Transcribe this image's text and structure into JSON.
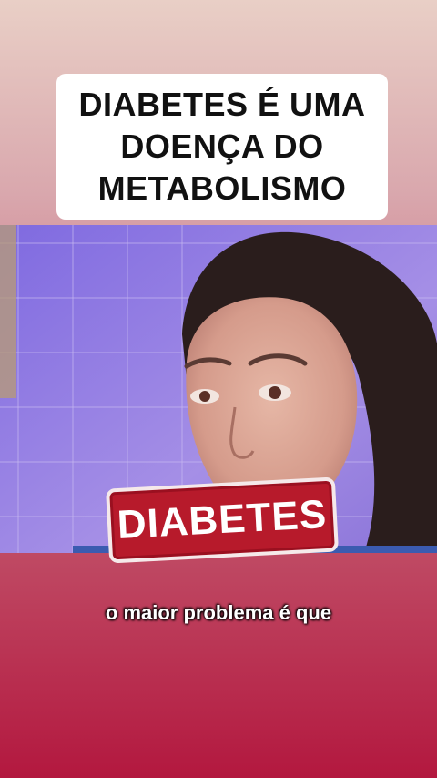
{
  "headline": {
    "line1": "DIABETES É UMA",
    "line2": "DOENÇA DO",
    "line3": "METABOLISMO"
  },
  "stamp_label": "DIABETES",
  "subtitle": "o maior problema é que",
  "colors": {
    "background_top": "#e9cfc6",
    "background_bottom": "#b3183f",
    "video_wall": "#6f5fd2",
    "stamp_red": "#b71a2b"
  }
}
